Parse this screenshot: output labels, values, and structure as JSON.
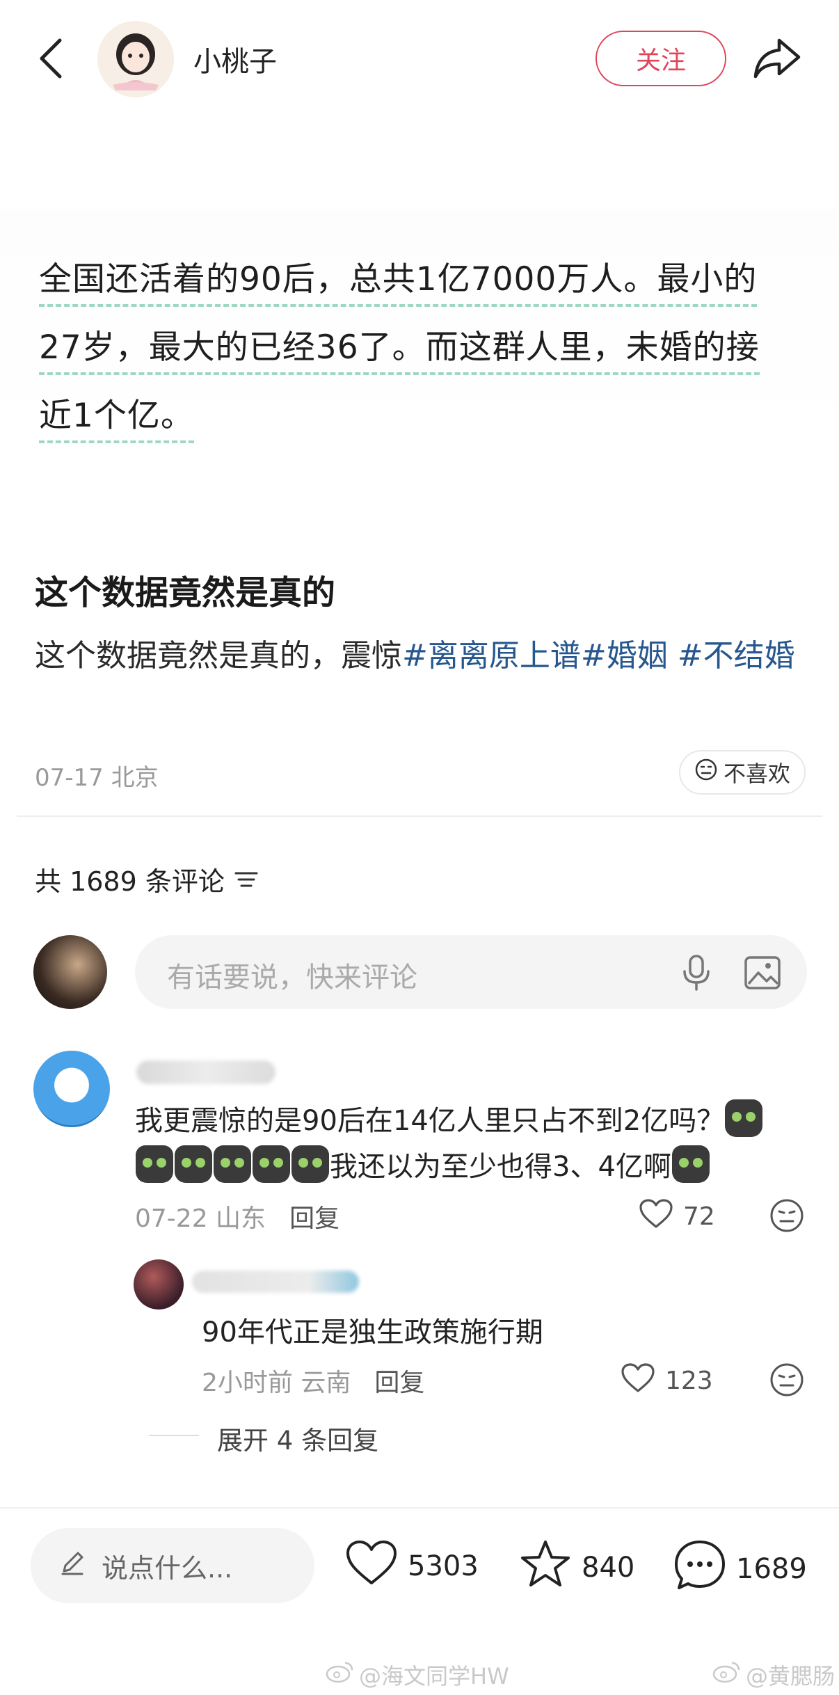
{
  "header": {
    "author_name": "小桃子",
    "follow_label": "关注"
  },
  "post_image_lines": [
    "全国还活着的90后，总共1亿7000万人。最小的",
    "27岁，最大的已经36了。而这群人里，未婚的接",
    "近1个亿。"
  ],
  "post": {
    "title": "这个数据竟然是真的",
    "text_plain": "这个数据竟然是真的，震惊",
    "tags": [
      "#离离原上谱",
      "#婚姻",
      " #不结婚"
    ],
    "meta": "07-17 北京",
    "dislike_label": "不喜欢"
  },
  "comments_header": {
    "label": "共 1689 条评论"
  },
  "comment_input": {
    "placeholder": "有话要说，快来评论"
  },
  "comment1": {
    "text_a": "我更震惊的是90后在14亿人里只占不到2亿吗？",
    "text_b": "我还以为至少也得3、4亿啊",
    "date": "07-22 山东",
    "reply_label": "回复",
    "likes": "72"
  },
  "reply1": {
    "text": "90年代正是独生政策施行期",
    "time": "2小时前 云南",
    "reply_label": "回复",
    "likes": "123"
  },
  "expand_label": "展开 4 条回复",
  "bottom_bar": {
    "say_placeholder": "说点什么...",
    "likes": "5303",
    "stars": "840",
    "comments": "1689"
  },
  "watermarks": [
    "@海文同学HW",
    "@黄腮肠"
  ],
  "colors": {
    "accent": "#e0455a",
    "tag": "#27578f",
    "underline": "#9fd8c0"
  }
}
